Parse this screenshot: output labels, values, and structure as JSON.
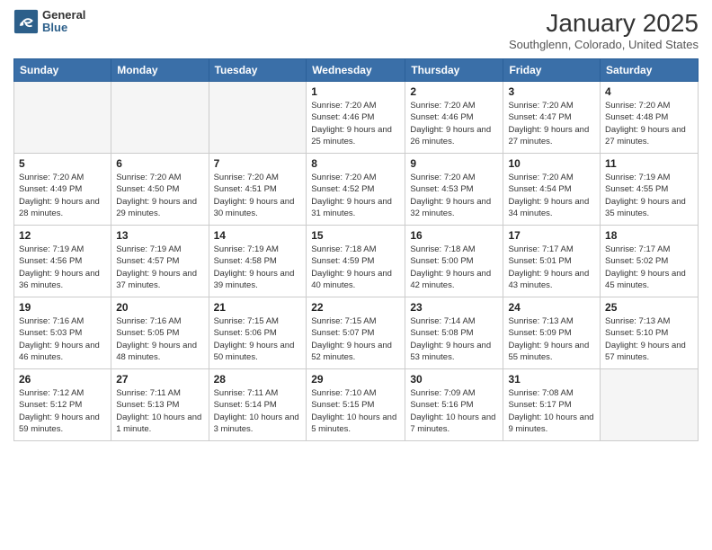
{
  "header": {
    "logo_general": "General",
    "logo_blue": "Blue",
    "month_title": "January 2025",
    "location": "Southglenn, Colorado, United States"
  },
  "days_of_week": [
    "Sunday",
    "Monday",
    "Tuesday",
    "Wednesday",
    "Thursday",
    "Friday",
    "Saturday"
  ],
  "weeks": [
    [
      {
        "day": "",
        "info": ""
      },
      {
        "day": "",
        "info": ""
      },
      {
        "day": "",
        "info": ""
      },
      {
        "day": "1",
        "info": "Sunrise: 7:20 AM\nSunset: 4:46 PM\nDaylight: 9 hours and 25 minutes."
      },
      {
        "day": "2",
        "info": "Sunrise: 7:20 AM\nSunset: 4:46 PM\nDaylight: 9 hours and 26 minutes."
      },
      {
        "day": "3",
        "info": "Sunrise: 7:20 AM\nSunset: 4:47 PM\nDaylight: 9 hours and 27 minutes."
      },
      {
        "day": "4",
        "info": "Sunrise: 7:20 AM\nSunset: 4:48 PM\nDaylight: 9 hours and 27 minutes."
      }
    ],
    [
      {
        "day": "5",
        "info": "Sunrise: 7:20 AM\nSunset: 4:49 PM\nDaylight: 9 hours and 28 minutes."
      },
      {
        "day": "6",
        "info": "Sunrise: 7:20 AM\nSunset: 4:50 PM\nDaylight: 9 hours and 29 minutes."
      },
      {
        "day": "7",
        "info": "Sunrise: 7:20 AM\nSunset: 4:51 PM\nDaylight: 9 hours and 30 minutes."
      },
      {
        "day": "8",
        "info": "Sunrise: 7:20 AM\nSunset: 4:52 PM\nDaylight: 9 hours and 31 minutes."
      },
      {
        "day": "9",
        "info": "Sunrise: 7:20 AM\nSunset: 4:53 PM\nDaylight: 9 hours and 32 minutes."
      },
      {
        "day": "10",
        "info": "Sunrise: 7:20 AM\nSunset: 4:54 PM\nDaylight: 9 hours and 34 minutes."
      },
      {
        "day": "11",
        "info": "Sunrise: 7:19 AM\nSunset: 4:55 PM\nDaylight: 9 hours and 35 minutes."
      }
    ],
    [
      {
        "day": "12",
        "info": "Sunrise: 7:19 AM\nSunset: 4:56 PM\nDaylight: 9 hours and 36 minutes."
      },
      {
        "day": "13",
        "info": "Sunrise: 7:19 AM\nSunset: 4:57 PM\nDaylight: 9 hours and 37 minutes."
      },
      {
        "day": "14",
        "info": "Sunrise: 7:19 AM\nSunset: 4:58 PM\nDaylight: 9 hours and 39 minutes."
      },
      {
        "day": "15",
        "info": "Sunrise: 7:18 AM\nSunset: 4:59 PM\nDaylight: 9 hours and 40 minutes."
      },
      {
        "day": "16",
        "info": "Sunrise: 7:18 AM\nSunset: 5:00 PM\nDaylight: 9 hours and 42 minutes."
      },
      {
        "day": "17",
        "info": "Sunrise: 7:17 AM\nSunset: 5:01 PM\nDaylight: 9 hours and 43 minutes."
      },
      {
        "day": "18",
        "info": "Sunrise: 7:17 AM\nSunset: 5:02 PM\nDaylight: 9 hours and 45 minutes."
      }
    ],
    [
      {
        "day": "19",
        "info": "Sunrise: 7:16 AM\nSunset: 5:03 PM\nDaylight: 9 hours and 46 minutes."
      },
      {
        "day": "20",
        "info": "Sunrise: 7:16 AM\nSunset: 5:05 PM\nDaylight: 9 hours and 48 minutes."
      },
      {
        "day": "21",
        "info": "Sunrise: 7:15 AM\nSunset: 5:06 PM\nDaylight: 9 hours and 50 minutes."
      },
      {
        "day": "22",
        "info": "Sunrise: 7:15 AM\nSunset: 5:07 PM\nDaylight: 9 hours and 52 minutes."
      },
      {
        "day": "23",
        "info": "Sunrise: 7:14 AM\nSunset: 5:08 PM\nDaylight: 9 hours and 53 minutes."
      },
      {
        "day": "24",
        "info": "Sunrise: 7:13 AM\nSunset: 5:09 PM\nDaylight: 9 hours and 55 minutes."
      },
      {
        "day": "25",
        "info": "Sunrise: 7:13 AM\nSunset: 5:10 PM\nDaylight: 9 hours and 57 minutes."
      }
    ],
    [
      {
        "day": "26",
        "info": "Sunrise: 7:12 AM\nSunset: 5:12 PM\nDaylight: 9 hours and 59 minutes."
      },
      {
        "day": "27",
        "info": "Sunrise: 7:11 AM\nSunset: 5:13 PM\nDaylight: 10 hours and 1 minute."
      },
      {
        "day": "28",
        "info": "Sunrise: 7:11 AM\nSunset: 5:14 PM\nDaylight: 10 hours and 3 minutes."
      },
      {
        "day": "29",
        "info": "Sunrise: 7:10 AM\nSunset: 5:15 PM\nDaylight: 10 hours and 5 minutes."
      },
      {
        "day": "30",
        "info": "Sunrise: 7:09 AM\nSunset: 5:16 PM\nDaylight: 10 hours and 7 minutes."
      },
      {
        "day": "31",
        "info": "Sunrise: 7:08 AM\nSunset: 5:17 PM\nDaylight: 10 hours and 9 minutes."
      },
      {
        "day": "",
        "info": ""
      }
    ]
  ]
}
